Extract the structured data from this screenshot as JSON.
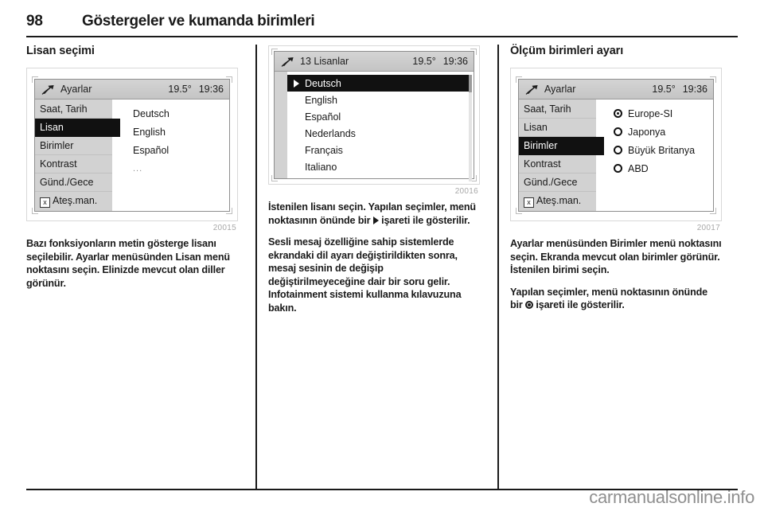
{
  "header": {
    "page_number": "98",
    "title": "Göstergeler ve kumanda birimleri"
  },
  "columns": [
    {
      "section_title": "Lisan seçimi",
      "figure": {
        "number": "20015",
        "display": {
          "top_label": "Ayarlar",
          "temperature": "19.5°",
          "clock": "19:36",
          "menu_items": [
            {
              "label": "Saat, Tarih",
              "selected": false,
              "checkbox": false
            },
            {
              "label": "Lisan",
              "selected": true,
              "checkbox": false
            },
            {
              "label": "Birimler",
              "selected": false,
              "checkbox": false
            },
            {
              "label": "Kontrast",
              "selected": false,
              "checkbox": false
            },
            {
              "label": "Günd./Gece",
              "selected": false,
              "checkbox": false
            },
            {
              "label": "Ateş.man.",
              "selected": false,
              "checkbox": true
            }
          ],
          "options": [
            {
              "label": "Deutsch",
              "dots": false
            },
            {
              "label": "English",
              "dots": false
            },
            {
              "label": "Español",
              "dots": false
            },
            {
              "label": "...",
              "dots": true
            }
          ]
        }
      },
      "paragraphs": [
        "Bazı fonksiyonların metin gösterge lisanı seçilebilir. Ayarlar menüsünden Lisan menü noktasını seçin. Elinizde mevcut olan diller görünür."
      ]
    },
    {
      "section_title": "",
      "figure": {
        "number": "20016",
        "display": {
          "top_label": "13 Lisanlar",
          "temperature": "19.5°",
          "clock": "19:36",
          "list_items": [
            {
              "label": "Deutsch",
              "selected": true
            },
            {
              "label": "English",
              "selected": false
            },
            {
              "label": "Español",
              "selected": false
            },
            {
              "label": "Nederlands",
              "selected": false
            },
            {
              "label": "Français",
              "selected": false
            },
            {
              "label": "Italiano",
              "selected": false
            }
          ]
        }
      },
      "paragraphs": [
        "İstenilen lisanı seçin. Yapılan seçimler, menü noktasının önünde bir",
        "işareti ile gösterilir.",
        "Sesli mesaj özelliğine sahip sistemlerde ekrandaki dil ayarı değiştirildikten sonra, mesaj sesinin de değişip değiştirilmeyeceğine dair bir soru gelir. Infotainment sistemi kullanma kılavuzuna bakın."
      ]
    },
    {
      "section_title": "Ölçüm birimleri ayarı",
      "figure": {
        "number": "20017",
        "display": {
          "top_label": "Ayarlar",
          "temperature": "19.5°",
          "clock": "19:36",
          "menu_items": [
            {
              "label": "Saat, Tarih",
              "selected": false,
              "checkbox": false
            },
            {
              "label": "Lisan",
              "selected": false,
              "checkbox": false
            },
            {
              "label": "Birimler",
              "selected": true,
              "checkbox": false
            },
            {
              "label": "Kontrast",
              "selected": false,
              "checkbox": false
            },
            {
              "label": "Günd./Gece",
              "selected": false,
              "checkbox": false
            },
            {
              "label": "Ateş.man.",
              "selected": false,
              "checkbox": true
            }
          ],
          "radio_options": [
            {
              "label": "Europe-SI",
              "checked": true
            },
            {
              "label": "Japonya",
              "checked": false
            },
            {
              "label": "Büyük Britanya",
              "checked": false
            },
            {
              "label": "ABD",
              "checked": false
            }
          ]
        }
      },
      "paragraphs": [
        "Ayarlar menüsünden Birimler menü noktasını seçin. Ekranda mevcut olan birimler görünür. İstenilen birimi seçin.",
        "Yapılan seçimler, menü noktasının önünde bir",
        "işareti ile gösterilir."
      ]
    }
  ],
  "footer": {
    "watermark": "carmanualsonline.info"
  },
  "icons": {
    "settings_wrench": "settings-wrench-icon",
    "checkbox_x": "x"
  }
}
